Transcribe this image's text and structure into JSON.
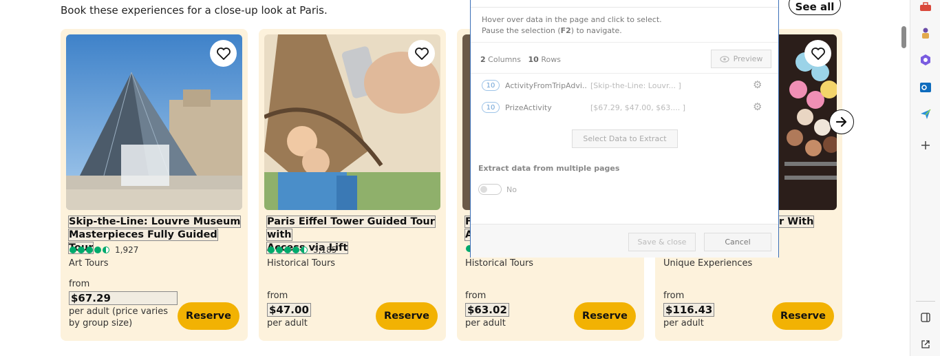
{
  "page": {
    "subtitle": "Book these experiences for a close-up look at Paris.",
    "see_all": "See all"
  },
  "cards": [
    {
      "title_line1": "Skip-the-Line: Louvre Museum",
      "title_line2": "Masterpieces Fully Guided Tour",
      "rating": 4.5,
      "reviews": "1,927",
      "category": "Art Tours",
      "from": "from",
      "price": "$67.29",
      "per": "per adult (price varies by group size)",
      "reserve": "Reserve"
    },
    {
      "title_line1": "Paris Eiffel Tower Guided Tour with",
      "title_line2": "Access via Lift",
      "rating": 4.5,
      "reviews": "3,185",
      "category": "Historical Tours",
      "from": "from",
      "price": "$47.00",
      "per": "per adult",
      "reserve": "Reserve"
    },
    {
      "title_line1": "F",
      "title_line2": "A",
      "category": "Historical Tours",
      "from": "from",
      "price": "$63.02",
      "per": "per adult",
      "reserve": "Reserve"
    },
    {
      "title_line1": "r With",
      "category": "Unique Experiences",
      "from": "from",
      "price": "$116.43",
      "per": "per adult",
      "reserve": "Reserve"
    }
  ],
  "extractor": {
    "hint_line1": "Hover over data in the page and click to select.",
    "hint_line2_a": "Pause the selection (",
    "hint_key": "F2",
    "hint_line2_b": ") to navigate.",
    "columns_count": "2",
    "columns_label": "Columns",
    "rows_count": "10",
    "rows_label": "Rows",
    "preview": "Preview",
    "fields": [
      {
        "count": "10",
        "name": "ActivityFromTripAdvi...",
        "preview": "[Skip-the-Line: Louvr... ]"
      },
      {
        "count": "10",
        "name": "PrizeActivity",
        "preview": "[$67.29, $47.00, $63.... ]"
      }
    ],
    "select_data": "Select Data to Extract",
    "multi_pages_label": "Extract data from multiple pages",
    "toggle_state": "No",
    "save_close": "Save & close",
    "cancel": "Cancel"
  },
  "sidebar": {
    "icons": [
      "toolbox-icon",
      "chess-icon",
      "copilot-icon",
      "outlook-icon",
      "send-icon",
      "add-icon",
      "sidebar-toggle-icon",
      "external-link-icon"
    ]
  },
  "colors": {
    "card_bg": "#fdf2dc",
    "reserve_bg": "#f2b203",
    "rating_green": "#00aa6c",
    "popup_border": "#3a6fb7"
  }
}
